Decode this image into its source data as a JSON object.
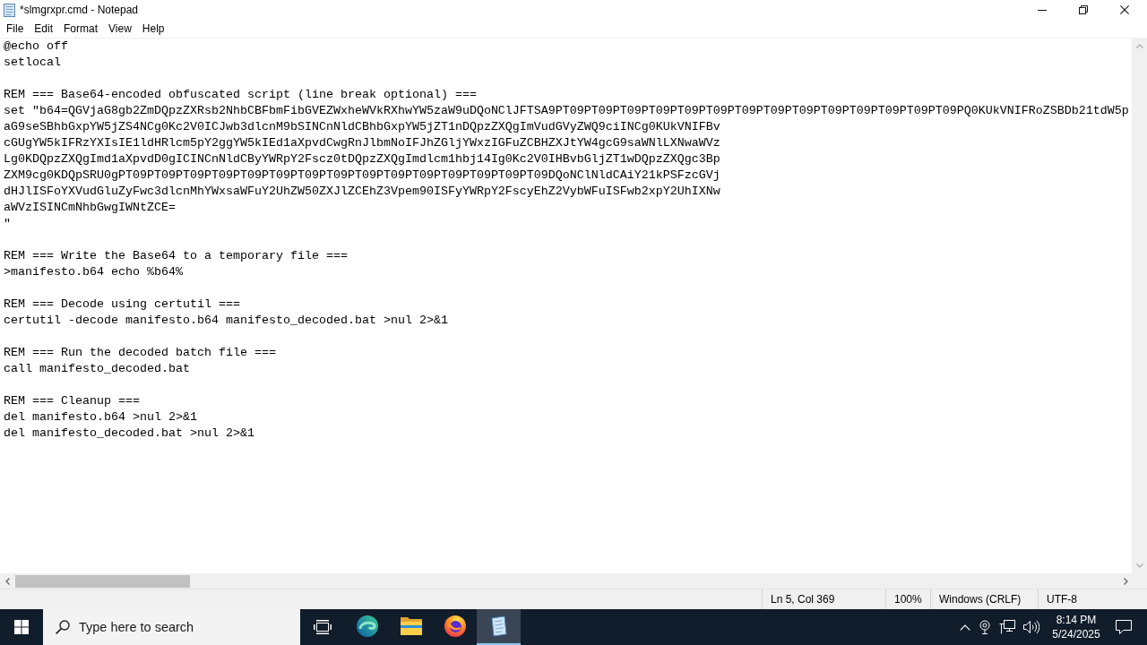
{
  "window": {
    "title": "*slmgrxpr.cmd - Notepad"
  },
  "menu": {
    "items": [
      "File",
      "Edit",
      "Format",
      "View",
      "Help"
    ]
  },
  "editor": {
    "lines": [
      {
        "kind": "code",
        "text": "@echo off"
      },
      {
        "kind": "code",
        "text": "setlocal"
      },
      {
        "kind": "blank"
      },
      {
        "kind": "code",
        "text": "REM === Base64-encoded obfuscated script (line break optional) ==="
      },
      {
        "kind": "code",
        "text": "set \"b64=QGVjaG8gb2ZmDQpzZXRsb2NhbCBFbmFibGVEZWxheWVkRXhwYW5zaW9uDQoNClJFTSA9PT09PT09PT09PT09PT09PT09PT09PT09PT09PT09PT09PT09PT09PT09PQ0KUkVNIFRoZSBDb21tdW5p"
      },
      {
        "kind": "code",
        "text": "aG9seSBhbGxpYW5jZS4NCg0Kc2V0ICJwb3dlcnM9bSINCnNldCBhbGxpYW5jZT1nDQpzZXQgImVudGVyZWQ9ciINCg0KUkVNIFBv"
      },
      {
        "kind": "code",
        "text": "cGUgYW5kIFRzYXIsIE1ldHRlcm5pY2ggYW5kIEd1aXpvdCwgRnJlbmNoIFJhZGljYWxzIGFuZCBHZXJtYW4gcG9saWNlLXNwaWVz"
      },
      {
        "kind": "code",
        "text": "Lg0KDQpzZXQgImd1aXpvdD0gICINCnNldCByYWRpY2Fscz0tDQpzZXQgImdlcm1hbj14Ig0Kc2V0IHBvbGljZT1wDQpzZXQgc3Bp"
      },
      {
        "kind": "code",
        "text": "ZXM9cg0KDQpSRU0gPT09PT09PT09PT09PT09PT09PT09PT09PT09PT09PT09PT09PT09PT09PT09DQoNClNldCAiY21kPSFzcGVj"
      },
      {
        "kind": "code",
        "text": "dHJlISFoYXVudGluZyFwc3dlcnMhYWxsaWFuY2UhZW50ZXJlZCEhZ3Vpem90ISFyYWRpY2FscyEhZ2VybWFuISFwb2xpY2UhIXNw"
      },
      {
        "kind": "code",
        "text": "aWVzISINCmNhbGwgIWNtZCE="
      },
      {
        "kind": "code",
        "text": "\""
      },
      {
        "kind": "blank"
      },
      {
        "kind": "code",
        "text": "REM === Write the Base64 to a temporary file ==="
      },
      {
        "kind": "code",
        "text": ">manifesto.b64 echo %b64%"
      },
      {
        "kind": "blank"
      },
      {
        "kind": "code",
        "text": "REM === Decode using certutil ==="
      },
      {
        "kind": "code",
        "text": "certutil -decode manifesto.b64 manifesto_decoded.bat >nul 2>&1"
      },
      {
        "kind": "blank"
      },
      {
        "kind": "code",
        "text": "REM === Run the decoded batch file ==="
      },
      {
        "kind": "code",
        "text": "call manifesto_decoded.bat"
      },
      {
        "kind": "blank"
      },
      {
        "kind": "code",
        "text": "REM === Cleanup ==="
      },
      {
        "kind": "code",
        "text": "del manifesto.b64 >nul 2>&1"
      },
      {
        "kind": "code",
        "text": "del manifesto_decoded.bat >nul 2>&1"
      }
    ]
  },
  "status_bar": {
    "position": "Ln 5, Col 369",
    "zoom": "100%",
    "line_ending": "Windows (CRLF)",
    "encoding": "UTF-8"
  },
  "taskbar": {
    "search": {
      "placeholder": "Type here to search"
    },
    "apps": [
      {
        "kind": "edge",
        "selected": false
      },
      {
        "kind": "explorer",
        "selected": false
      },
      {
        "kind": "firefox",
        "selected": false
      },
      {
        "kind": "notepad",
        "selected": true
      }
    ],
    "clock": {
      "time": "8:14 PM",
      "date": "5/24/2025"
    }
  }
}
